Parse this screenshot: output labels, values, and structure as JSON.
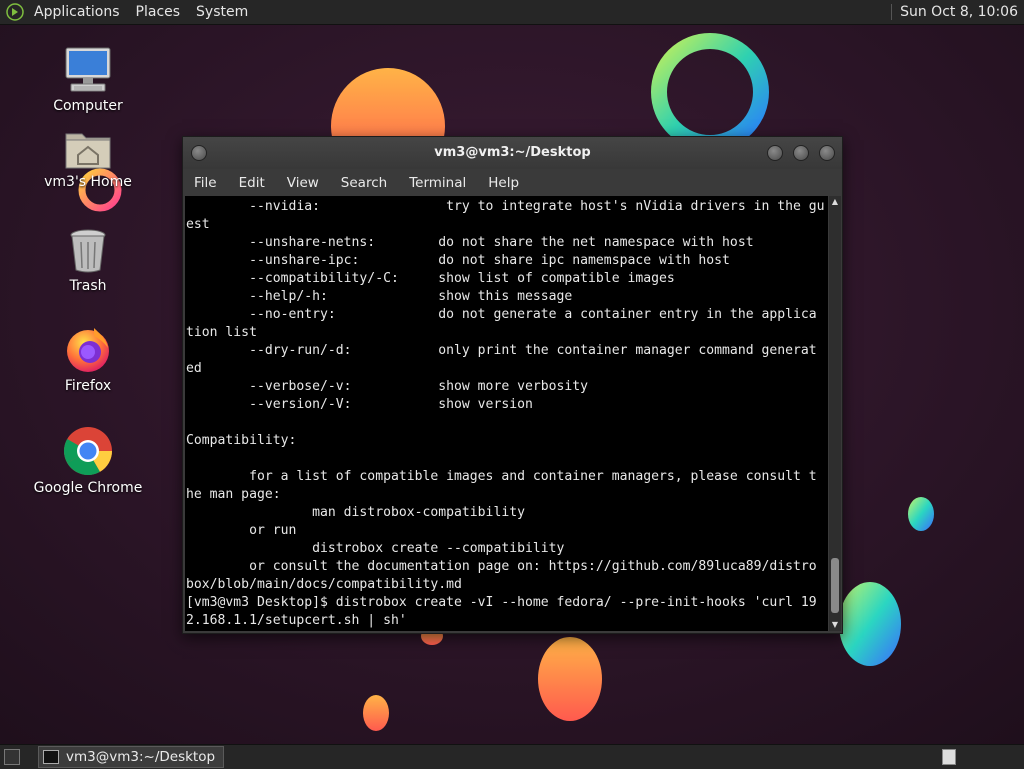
{
  "top_panel": {
    "menus": [
      "Applications",
      "Places",
      "System"
    ],
    "clock": "Sun Oct  8, 10:06"
  },
  "desktop_icons": [
    {
      "name": "computer",
      "label": "Computer",
      "icon": "computer-icon"
    },
    {
      "name": "home",
      "label": "vm3's Home",
      "icon": "home-folder-icon"
    },
    {
      "name": "trash",
      "label": "Trash",
      "icon": "trash-icon"
    },
    {
      "name": "firefox",
      "label": "Firefox",
      "icon": "firefox-icon"
    },
    {
      "name": "chrome",
      "label": "Google Chrome",
      "icon": "chrome-icon"
    }
  ],
  "terminal": {
    "title": "vm3@vm3:~/Desktop",
    "menu": [
      "File",
      "Edit",
      "View",
      "Search",
      "Terminal",
      "Help"
    ],
    "output": "        --nvidia:                try to integrate host's nVidia drivers in the gu\nest\n        --unshare-netns:        do not share the net namespace with host\n        --unshare-ipc:          do not share ipc namemspace with host\n        --compatibility/-C:     show list of compatible images\n        --help/-h:              show this message\n        --no-entry:             do not generate a container entry in the applica\ntion list\n        --dry-run/-d:           only print the container manager command generat\ned\n        --verbose/-v:           show more verbosity\n        --version/-V:           show version\n\nCompatibility:\n\n        for a list of compatible images and container managers, please consult t\nhe man page:\n                man distrobox-compatibility\n        or run\n                distrobox create --compatibility\n        or consult the documentation page on: https://github.com/89luca89/distro\nbox/blob/main/docs/compatibility.md\n[vm3@vm3 Desktop]$ distrobox create -vI --home fedora/ --pre-init-hooks 'curl 19\n2.168.1.1/setupcert.sh | sh'"
  },
  "taskbar": {
    "tasks": [
      {
        "label": "vm3@vm3:~/Desktop"
      }
    ]
  },
  "colors": {
    "panel_bg": "#262626",
    "terminal_bg": "#000000",
    "terminal_fg": "#e8e8e8",
    "wallpaper_bg": "#2a1526"
  }
}
